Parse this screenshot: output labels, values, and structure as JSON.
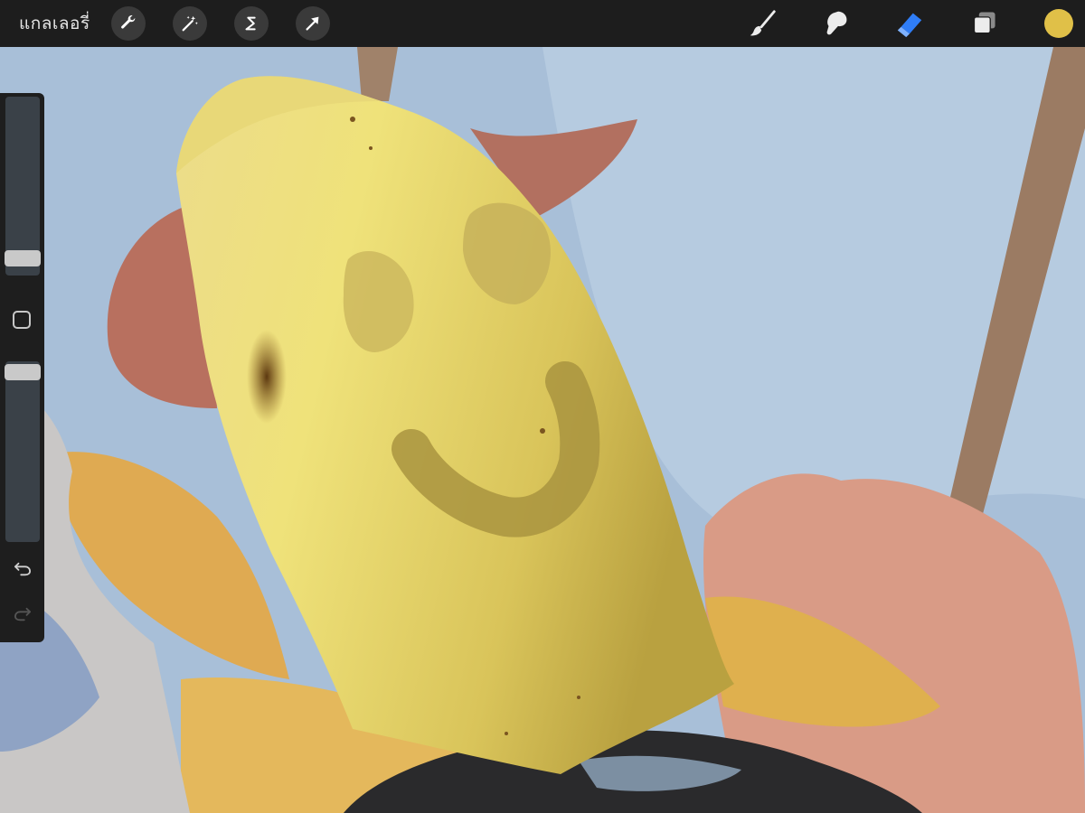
{
  "toolbar": {
    "gallery_label": "แกลเลอรี่",
    "left_tools": [
      {
        "name": "actions-icon"
      },
      {
        "name": "adjustments-icon"
      },
      {
        "name": "selection-icon"
      },
      {
        "name": "transform-icon"
      }
    ],
    "right_tools": [
      {
        "name": "brush-icon"
      },
      {
        "name": "smudge-icon"
      },
      {
        "name": "eraser-icon",
        "active": true
      },
      {
        "name": "layers-icon"
      }
    ],
    "current_color": "#e0c048",
    "active_tool_color": "#2f7df6"
  },
  "sidebar": {
    "brush_size_level": 0.88,
    "opacity_level": 0.0
  }
}
